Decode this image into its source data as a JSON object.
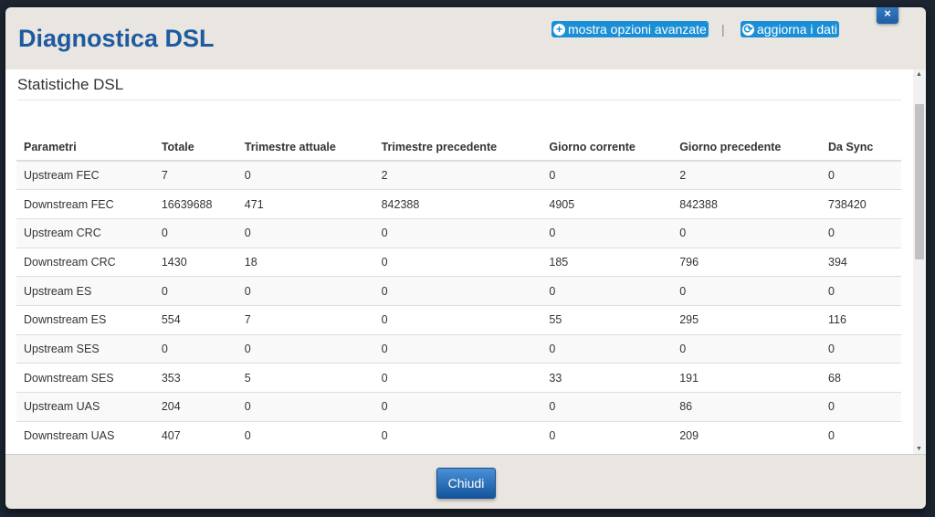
{
  "header": {
    "title": "Diagnostica DSL",
    "advanced_label": "mostra opzioni avanzate",
    "refresh_label": "aggiorna i dati",
    "separator": "|",
    "close_icon": "×"
  },
  "section": {
    "title": "Statistiche DSL"
  },
  "table": {
    "columns": [
      "Parametri",
      "Totale",
      "Trimestre attuale",
      "Trimestre precedente",
      "Giorno corrente",
      "Giorno precedente",
      "Da Sync"
    ],
    "rows": [
      [
        "Upstream FEC",
        "7",
        "0",
        "2",
        "0",
        "2",
        "0"
      ],
      [
        "Downstream FEC",
        "16639688",
        "471",
        "842388",
        "4905",
        "842388",
        "738420"
      ],
      [
        "Upstream CRC",
        "0",
        "0",
        "0",
        "0",
        "0",
        "0"
      ],
      [
        "Downstream CRC",
        "1430",
        "18",
        "0",
        "185",
        "796",
        "394"
      ],
      [
        "Upstream ES",
        "0",
        "0",
        "0",
        "0",
        "0",
        "0"
      ],
      [
        "Downstream ES",
        "554",
        "7",
        "0",
        "55",
        "295",
        "116"
      ],
      [
        "Upstream SES",
        "0",
        "0",
        "0",
        "0",
        "0",
        "0"
      ],
      [
        "Downstream SES",
        "353",
        "5",
        "0",
        "33",
        "191",
        "68"
      ],
      [
        "Upstream UAS",
        "204",
        "0",
        "0",
        "0",
        "86",
        "0"
      ],
      [
        "Downstream UAS",
        "407",
        "0",
        "0",
        "0",
        "209",
        "0"
      ]
    ]
  },
  "footer": {
    "close_label": "Chiudi"
  }
}
